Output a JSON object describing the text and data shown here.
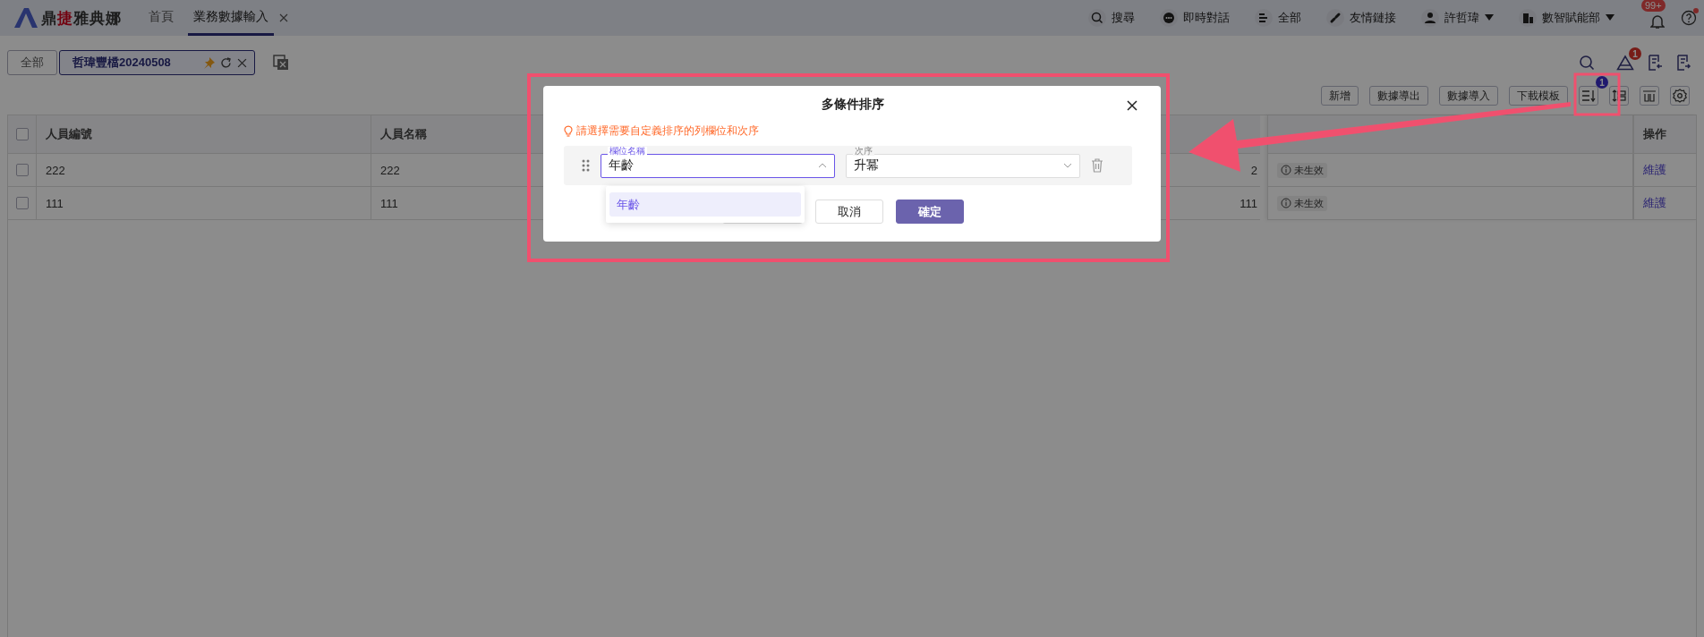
{
  "logo": [
    {
      "text": "鼎",
      "color": "#1c1c1c"
    },
    {
      "text": "捷",
      "color": "#72010f"
    },
    {
      "text": "雅典娜",
      "color": "#1c1c1c"
    }
  ],
  "nav_tabs": [
    {
      "label": "首頁",
      "selected": false,
      "closable": false
    },
    {
      "label": "業務數據輸入",
      "selected": true,
      "closable": true
    }
  ],
  "top_actions": [
    {
      "kind": "search",
      "label": "搜尋",
      "dropdown": false
    },
    {
      "kind": "chat",
      "label": "即時對話",
      "dropdown": false
    },
    {
      "kind": "all",
      "label": "全部",
      "dropdown": false
    },
    {
      "kind": "link",
      "label": "友情鏈接",
      "dropdown": false
    },
    {
      "kind": "user",
      "label": "許哲瑋",
      "dropdown": true
    },
    {
      "kind": "org",
      "label": "數智賦能部",
      "dropdown": true
    }
  ],
  "notifications": {
    "badge": "99+"
  },
  "help": {
    "unread": true
  },
  "page_tabs": [
    {
      "label": "全部",
      "selected": false,
      "pinned": false
    },
    {
      "label": "哲瑋豐檔20240508",
      "selected": true,
      "pinned": true
    }
  ],
  "alerts_badge": "1",
  "toolbar": {
    "buttons": [
      "新增",
      "數據導出",
      "數據導入",
      "下載模板"
    ],
    "sort_badge": "1"
  },
  "table": {
    "all_checked": false,
    "columns": [
      "人員編號",
      "人員名稱"
    ],
    "action_column": "操作",
    "rows": [
      {
        "checked": false,
        "cells": [
          "222",
          "222",
          "2"
        ],
        "status": "未生效",
        "action": "維護"
      },
      {
        "checked": false,
        "cells": [
          "111",
          "111",
          "111"
        ],
        "status": "未生效",
        "action": "維護"
      }
    ]
  },
  "dialog": {
    "title": "多條件排序",
    "hint": "請選擇需要自定義排序的列欄位和次序",
    "rules": [
      {
        "field_label": "欄位名稱",
        "field_value": "年齡",
        "order_label": "次序",
        "order_value": "升冪",
        "open": true
      }
    ],
    "options": [
      {
        "label": "年齡",
        "selected": true
      }
    ],
    "buttons": [
      {
        "kind": "covered"
      },
      {
        "kind": "default",
        "label": "取消"
      },
      {
        "kind": "primary",
        "label": "確定"
      }
    ]
  }
}
